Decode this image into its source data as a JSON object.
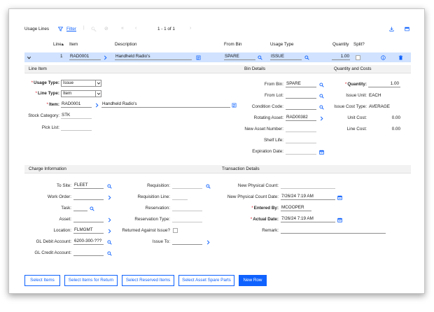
{
  "toolbar": {
    "title": "Usage Lines",
    "filter_label": "Filter",
    "pagination": "1 - 1 of 1"
  },
  "table": {
    "columns": [
      "Line",
      "Item",
      "Description",
      "From Bin",
      "Usage Type",
      "Quantity",
      "Split?"
    ],
    "row": {
      "line": "1",
      "item": "RAD0001",
      "description": "Handheld Radio's",
      "from_bin": "SPARE",
      "usage_type": "ISSUE",
      "quantity": "1.00"
    }
  },
  "line_item": {
    "header": "Line Item",
    "usage_type_label": "Usage Type:",
    "usage_type_value": "Issue",
    "line_type_label": "Line Type:",
    "line_type_value": "Item",
    "item_label": "Item:",
    "item_value": "RAD0001",
    "item_description": "Handheld Radio's",
    "stock_category_label": "Stock Category:",
    "stock_category_value": "STK",
    "pick_list_label": "Pick List:",
    "pick_list_value": ""
  },
  "bin_details": {
    "header": "Bin Details",
    "from_bin_label": "From Bin:",
    "from_bin_value": "SPARE",
    "from_lot_label": "From Lot:",
    "from_lot_value": "",
    "condition_code_label": "Condition Code:",
    "condition_code_value": "",
    "rotating_asset_label": "Rotating Asset:",
    "rotating_asset_value": "RAD00382",
    "new_asset_number_label": "New Asset Number:",
    "new_asset_number_value": "",
    "shelf_life_label": "Shelf Life:",
    "shelf_life_value": "",
    "expiration_date_label": "Expiration Date:",
    "expiration_date_value": ""
  },
  "quantity_costs": {
    "header": "Quantity and Costs",
    "quantity_label": "Quantity:",
    "quantity_value": "1.00",
    "issue_unit_label": "Issue Unit:",
    "issue_unit_value": "EACH",
    "issue_cost_type_label": "Issue Cost Type:",
    "issue_cost_type_value": "AVERAGE",
    "unit_cost_label": "Unit Cost:",
    "unit_cost_value": "0.00",
    "line_cost_label": "Line Cost:",
    "line_cost_value": "0.00"
  },
  "charge_information": {
    "header": "Charge Information",
    "to_site_label": "To Site:",
    "to_site_value": "FLEET",
    "work_order_label": "Work Order:",
    "work_order_value": "",
    "task_label": "Task:",
    "task_value": "",
    "asset_label": "Asset:",
    "asset_value": "",
    "location_label": "Location:",
    "location_value": "FLMGMT",
    "gl_debit_label": "GL Debit Account:",
    "gl_debit_value": "6200-300-???",
    "gl_credit_label": "GL Credit Account:",
    "gl_credit_value": "",
    "requisition_label": "Requisition:",
    "requisition_value": "",
    "requisition_line_label": "Requisition Line:",
    "requisition_line_value": "",
    "reservation_label": "Reservation:",
    "reservation_value": "",
    "reservation_type_label": "Reservation Type:",
    "reservation_type_value": "",
    "returned_against_issue_label": "Returned Against Issue?",
    "issue_to_label": "Issue To:",
    "issue_to_value": ""
  },
  "transaction_details": {
    "header": "Transaction Details",
    "new_physical_count_label": "New Physical Count:",
    "new_physical_count_value": "",
    "new_physical_count_date_label": "New Physical Count Date:",
    "new_physical_count_date_value": "7/26/24 7:19 AM",
    "entered_by_label": "Entered By:",
    "entered_by_value": "MCOOPER",
    "actual_date_label": "Actual Date:",
    "actual_date_value": "7/26/24 7:19 AM",
    "remark_label": "Remark:",
    "remark_value": ""
  },
  "footer": {
    "select_items": "Select Items",
    "select_items_for_return": "Select Items for Return",
    "select_reserved_items": "Select Reserved Items",
    "select_asset_spare_parts": "Select Asset Spare Parts",
    "new_row": "New Row"
  },
  "colors": {
    "accent": "#0f62fe",
    "selected_row": "#d0e2ff",
    "section_header": "#f2f2f2",
    "required": "#da1e28"
  }
}
